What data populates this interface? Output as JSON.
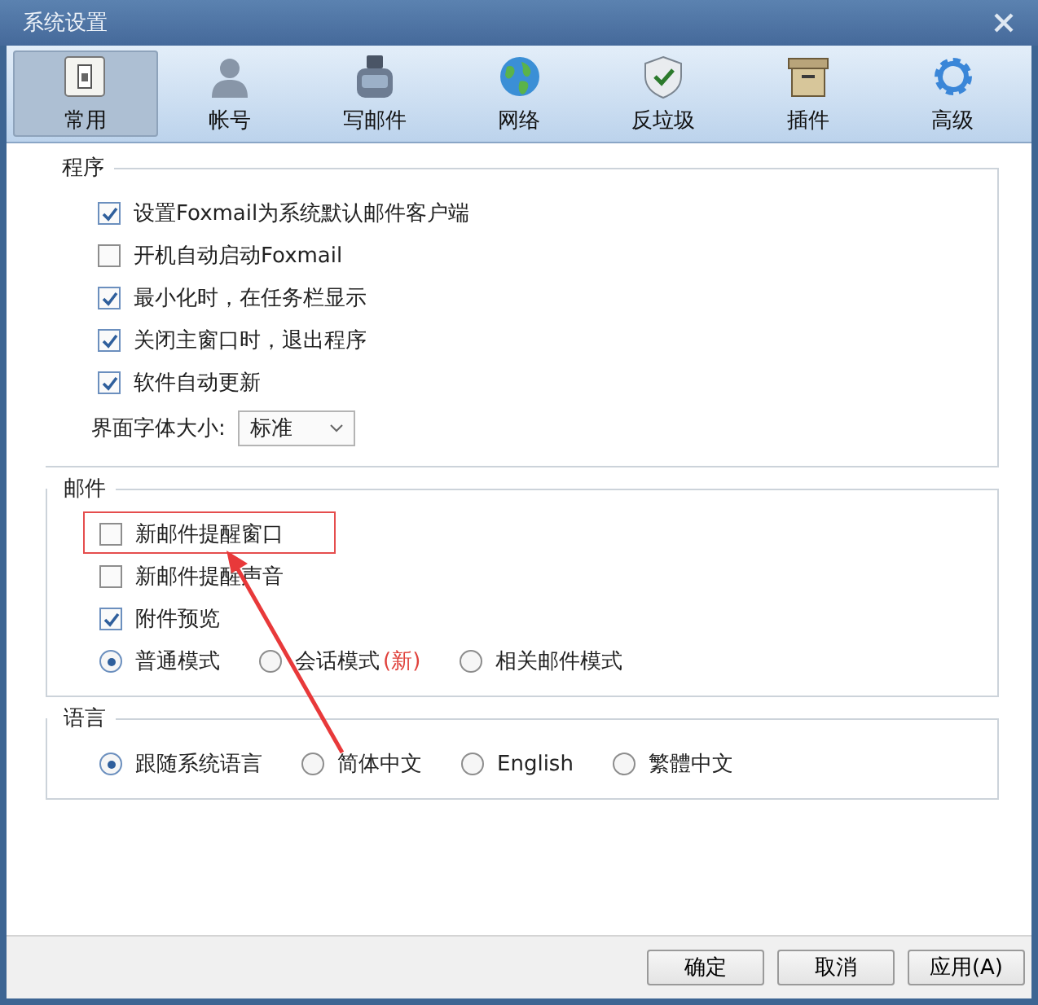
{
  "window": {
    "title": "系统设置"
  },
  "tabs": [
    {
      "label": "常用",
      "selected": true
    },
    {
      "label": "帐号",
      "selected": false
    },
    {
      "label": "写邮件",
      "selected": false
    },
    {
      "label": "网络",
      "selected": false
    },
    {
      "label": "反垃圾",
      "selected": false
    },
    {
      "label": "插件",
      "selected": false
    },
    {
      "label": "高级",
      "selected": false
    }
  ],
  "groups": [
    {
      "title": "程序",
      "items": [
        {
          "kind": "checkbox",
          "label": "设置Foxmail为系统默认邮件客户端",
          "checked": true
        },
        {
          "kind": "checkbox",
          "label": "开机自动启动Foxmail",
          "checked": false
        },
        {
          "kind": "checkbox",
          "label": "最小化时，在任务栏显示",
          "checked": true
        },
        {
          "kind": "checkbox",
          "label": "关闭主窗口时，退出程序",
          "checked": true
        },
        {
          "kind": "checkbox",
          "label": "软件自动更新",
          "checked": true
        },
        {
          "kind": "dropdown",
          "label": "界面字体大小:",
          "value": "标准"
        }
      ]
    },
    {
      "title": "邮件",
      "items": [
        {
          "kind": "checkbox",
          "label": "新邮件提醒窗口",
          "checked": false,
          "highlighted": true
        },
        {
          "kind": "checkbox",
          "label": "新邮件提醒声音",
          "checked": false
        },
        {
          "kind": "checkbox",
          "label": "附件预览",
          "checked": true
        },
        {
          "kind": "radios",
          "options": [
            {
              "label": "普通模式",
              "selected": true
            },
            {
              "label": "会话模式",
              "badge": "(新)",
              "selected": false
            },
            {
              "label": "相关邮件模式",
              "selected": false
            }
          ]
        }
      ]
    },
    {
      "title": "语言",
      "items": [
        {
          "kind": "radios",
          "options": [
            {
              "label": "跟随系统语言",
              "selected": true
            },
            {
              "label": "简体中文",
              "selected": false
            },
            {
              "label": "English",
              "selected": false
            },
            {
              "label": "繁體中文",
              "selected": false
            }
          ]
        }
      ]
    }
  ],
  "buttons": [
    "确定",
    "取消",
    "应用(A)"
  ]
}
